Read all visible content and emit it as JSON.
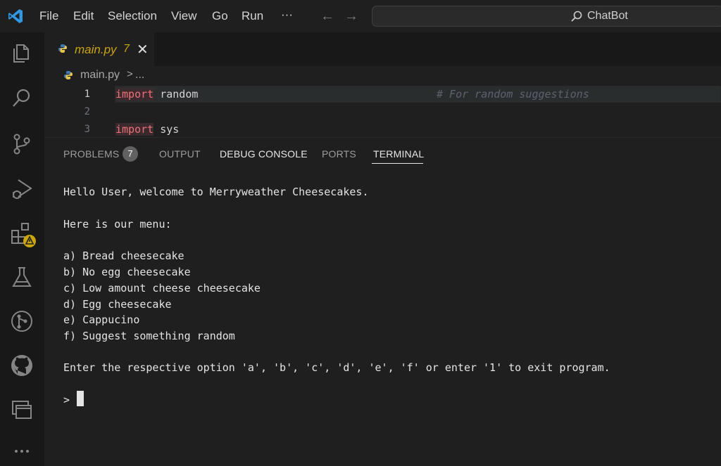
{
  "titlebar": {
    "menu": [
      "File",
      "Edit",
      "Selection",
      "View",
      "Go",
      "Run",
      "···"
    ],
    "search_label": "ChatBot"
  },
  "activitybar": {
    "icons": [
      "explorer-icon",
      "search-icon",
      "source-control-icon",
      "run-debug-icon",
      "extensions-icon",
      "testing-icon",
      "git-graph-icon",
      "github-icon",
      "remote-explorer-icon",
      "more-icon"
    ]
  },
  "editor": {
    "tab": {
      "name": "main.py",
      "problem_count": "7"
    },
    "breadcrumb": {
      "file": "main.py",
      "separator": ">",
      "more": "..."
    },
    "lines": [
      {
        "number": "1",
        "keyword": "import",
        "rest": " random",
        "comment": "# For random suggestions"
      },
      {
        "number": "2",
        "keyword": "",
        "rest": "",
        "comment": ""
      },
      {
        "number": "3",
        "keyword": "import",
        "rest": " sys",
        "comment": ""
      }
    ]
  },
  "panel": {
    "tabs": [
      {
        "label": "PROBLEMS",
        "badge": "7"
      },
      {
        "label": "OUTPUT"
      },
      {
        "label": "DEBUG CONSOLE"
      },
      {
        "label": "PORTS"
      },
      {
        "label": "TERMINAL"
      }
    ],
    "active_tab": "TERMINAL",
    "terminal_lines": [
      "Hello User, welcome to Merryweather Cheesecakes.",
      "Here is our menu:",
      "a) Bread cheesecake",
      "b) No egg cheesecake",
      "c) Low amount cheese cheesecake",
      "d) Egg cheesecake",
      "e) Cappucino",
      "f) Suggest something random",
      "Enter the respective option 'a', 'b', 'c', 'd', 'e', 'f' or enter '1' to exit program."
    ],
    "prompt": ">"
  },
  "colors": {
    "accent": "#0078d4",
    "warning": "#cca700",
    "keyword": "#f07178",
    "background": "#1f1f1f"
  }
}
